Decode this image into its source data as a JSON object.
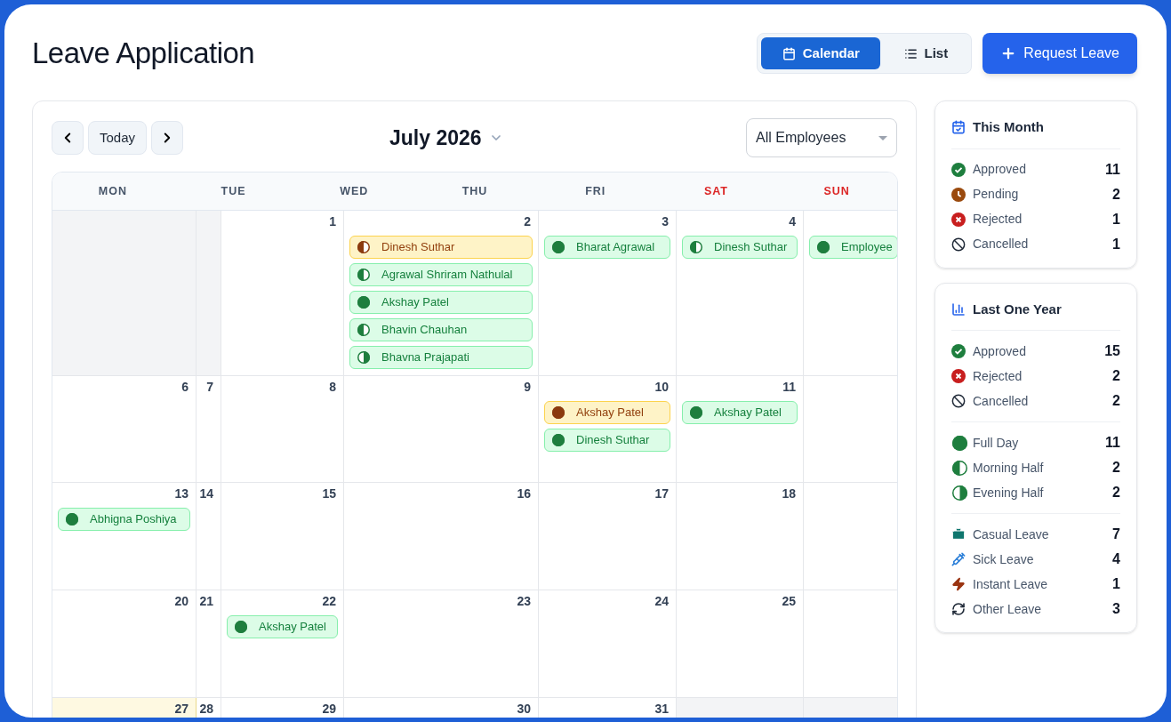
{
  "title": "Leave Application",
  "view_toggle": [
    {
      "label": "Calendar",
      "kind": "calendar",
      "selected": true
    },
    {
      "label": "List",
      "kind": "list",
      "selected": false
    }
  ],
  "request_button": "Request Leave",
  "toolbar": {
    "today_button": "Today",
    "month": "July 2026",
    "employee_filter": "All Employees"
  },
  "calendar": {
    "weekdays": [
      {
        "label": "MON",
        "weekend": false
      },
      {
        "label": "TUE",
        "weekend": false
      },
      {
        "label": "WED",
        "weekend": false
      },
      {
        "label": "THU",
        "weekend": false
      },
      {
        "label": "FRI",
        "weekend": false
      },
      {
        "label": "SAT",
        "weekend": true
      },
      {
        "label": "SUN",
        "weekend": true
      }
    ],
    "weeks": [
      [
        {
          "outside": true,
          "today": false
        },
        {
          "outside": true,
          "today": false
        },
        {
          "date": "1",
          "outside": false,
          "today": false
        },
        {
          "date": "2",
          "outside": false,
          "today": false,
          "events": [
            {
              "name": "Dinesh Suthar",
              "pending": true,
              "kind": "morning"
            },
            {
              "name": "Agrawal Shriram Nathulal",
              "pending": false,
              "kind": "morning"
            },
            {
              "name": "Akshay Patel",
              "pending": false,
              "kind": "full"
            },
            {
              "name": "Bhavin Chauhan",
              "pending": false,
              "kind": "morning"
            },
            {
              "name": "Bhavna Prajapati",
              "pending": false,
              "kind": "evening"
            }
          ]
        },
        {
          "date": "3",
          "outside": false,
          "today": false,
          "events": [
            {
              "name": "Bharat Agrawal",
              "pending": false,
              "kind": "full"
            }
          ]
        },
        {
          "date": "4",
          "outside": false,
          "today": false,
          "events": [
            {
              "name": "Dinesh Suthar",
              "pending": false,
              "kind": "morning"
            }
          ]
        },
        {
          "outside": false,
          "today": false,
          "events": [
            {
              "name": "Employee",
              "pending": false,
              "kind": "full"
            }
          ]
        }
      ],
      [
        {
          "date": "6",
          "outside": false,
          "today": false
        },
        {
          "date": "7",
          "outside": false,
          "today": false
        },
        {
          "date": "8",
          "outside": false,
          "today": false
        },
        {
          "date": "9",
          "outside": false,
          "today": false
        },
        {
          "date": "10",
          "outside": false,
          "today": false,
          "events": [
            {
              "name": "Akshay Patel",
              "pending": true,
              "kind": "full"
            },
            {
              "name": "Dinesh Suthar",
              "pending": false,
              "kind": "full"
            }
          ]
        },
        {
          "date": "11",
          "outside": false,
          "today": false,
          "events": [
            {
              "name": "Akshay Patel",
              "pending": false,
              "kind": "full"
            }
          ]
        },
        {
          "outside": false,
          "today": false
        }
      ],
      [
        {
          "date": "13",
          "outside": false,
          "today": false,
          "events": [
            {
              "name": "Abhigna Poshiya",
              "pending": false,
              "kind": "full"
            }
          ]
        },
        {
          "date": "14",
          "outside": false,
          "today": false
        },
        {
          "date": "15",
          "outside": false,
          "today": false
        },
        {
          "date": "16",
          "outside": false,
          "today": false
        },
        {
          "date": "17",
          "outside": false,
          "today": false
        },
        {
          "date": "18",
          "outside": false,
          "today": false
        },
        {
          "outside": false,
          "today": false
        }
      ],
      [
        {
          "date": "20",
          "outside": false,
          "today": false
        },
        {
          "date": "21",
          "outside": false,
          "today": false
        },
        {
          "date": "22",
          "outside": false,
          "today": false,
          "events": [
            {
              "name": "Akshay Patel",
              "pending": false,
              "kind": "full"
            }
          ]
        },
        {
          "date": "23",
          "outside": false,
          "today": false
        },
        {
          "date": "24",
          "outside": false,
          "today": false
        },
        {
          "date": "25",
          "outside": false,
          "today": false
        },
        {
          "outside": false,
          "today": false
        }
      ],
      [
        {
          "date": "27",
          "outside": false,
          "today": true
        },
        {
          "date": "28",
          "outside": false,
          "today": false
        },
        {
          "date": "29",
          "outside": false,
          "today": false
        },
        {
          "date": "30",
          "outside": false,
          "today": false
        },
        {
          "date": "31",
          "outside": false,
          "today": false
        },
        {
          "outside": true,
          "today": false
        },
        {
          "outside": true,
          "today": false
        }
      ]
    ]
  },
  "summary_cards": [
    {
      "title": "This Month",
      "kind": "month",
      "groups": [
        [
          {
            "kind": "approved",
            "label": "Approved",
            "count": "11"
          },
          {
            "kind": "pending",
            "label": "Pending",
            "count": "2"
          },
          {
            "kind": "rejected",
            "label": "Rejected",
            "count": "1"
          },
          {
            "kind": "cancelled",
            "label": "Cancelled",
            "count": "1"
          }
        ]
      ]
    },
    {
      "title": "Last One Year",
      "kind": "year",
      "groups": [
        [
          {
            "kind": "approved",
            "label": "Approved",
            "count": "15"
          },
          {
            "kind": "rejected",
            "label": "Rejected",
            "count": "2"
          },
          {
            "kind": "cancelled",
            "label": "Cancelled",
            "count": "2"
          }
        ],
        [
          {
            "kind": "full",
            "label": "Full Day",
            "count": "11"
          },
          {
            "kind": "morning",
            "label": "Morning Half",
            "count": "2"
          },
          {
            "kind": "evening",
            "label": "Evening Half",
            "count": "2"
          }
        ],
        [
          {
            "kind": "casual",
            "label": "Casual Leave",
            "count": "7"
          },
          {
            "kind": "sick",
            "label": "Sick Leave",
            "count": "4"
          },
          {
            "kind": "instant",
            "label": "Instant Leave",
            "count": "1"
          },
          {
            "kind": "other",
            "label": "Other Leave",
            "count": "3"
          }
        ]
      ]
    }
  ]
}
